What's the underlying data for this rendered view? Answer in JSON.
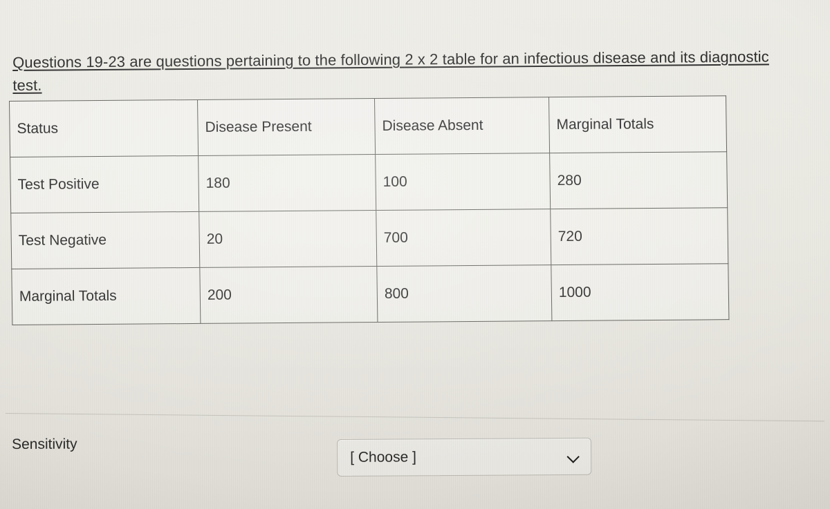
{
  "prompt": {
    "text": "Questions 19-23 are questions pertaining to the following 2 x 2 table for an infectious disease and its diagnostic test."
  },
  "table": {
    "headers": [
      "Status",
      "Disease Present",
      "Disease Absent",
      "Marginal Totals"
    ],
    "rows": [
      {
        "label": "Test Positive",
        "present": "180",
        "absent": "100",
        "total": "280"
      },
      {
        "label": "Test Negative",
        "present": "20",
        "absent": "700",
        "total": "720"
      },
      {
        "label": "Marginal Totals",
        "present": "200",
        "absent": "800",
        "total": "1000"
      }
    ]
  },
  "question": {
    "label": "Sensitivity",
    "select": {
      "value": "[ Choose ]",
      "chevron_icon": "chevron-down-icon"
    }
  },
  "colors": {
    "page_background": "#e9e8e1",
    "text": "#272727",
    "table_border": "#5c5c57",
    "divider": "#c3c1ba",
    "select_border": "#b9b7b0"
  }
}
